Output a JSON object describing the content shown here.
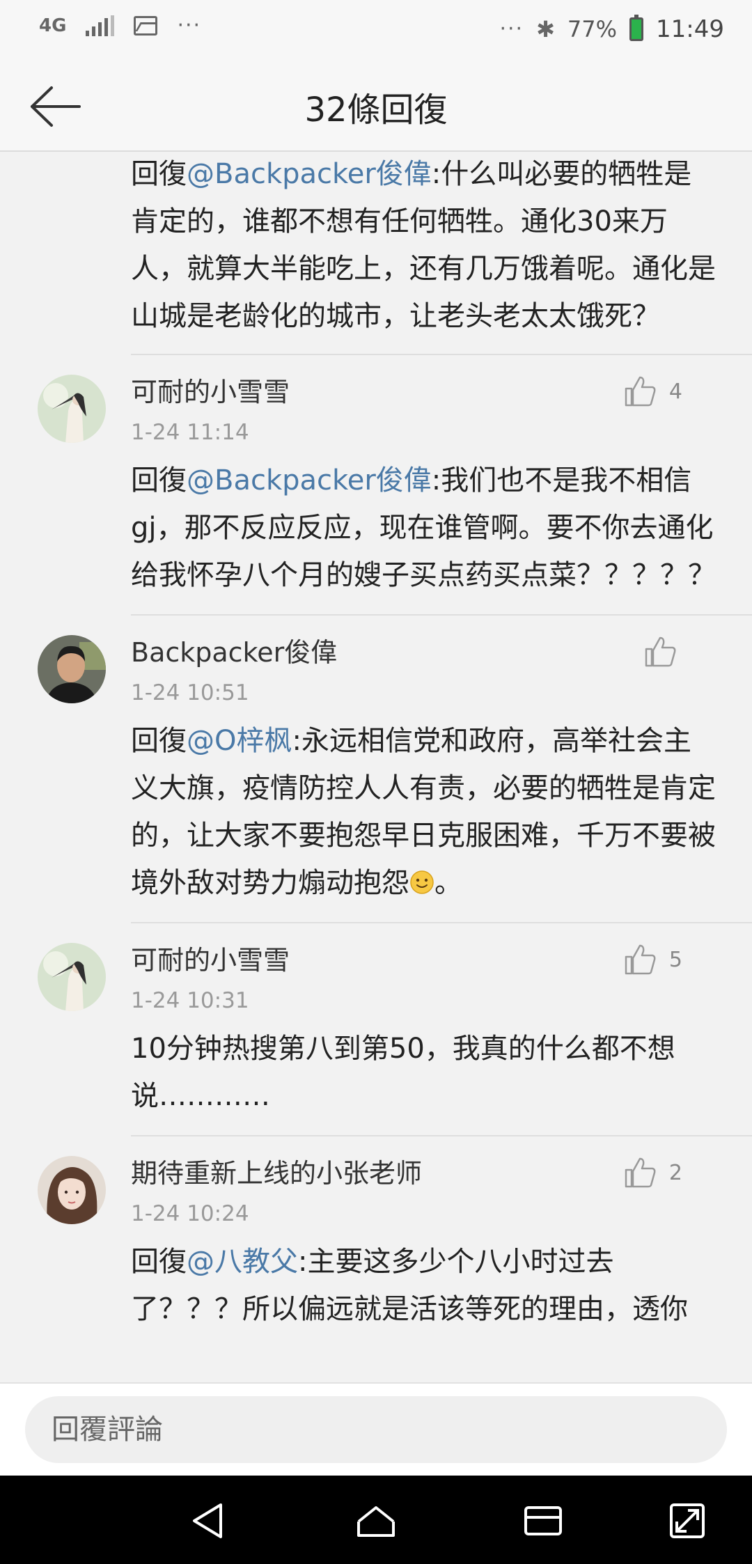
{
  "status_bar": {
    "network": "4G",
    "dots": "···",
    "battery_percent": "77%",
    "time": "11:49"
  },
  "header": {
    "title": "32條回復",
    "back_icon": "arrow-left-icon"
  },
  "reply_prefix": "回復",
  "continued_comment": {
    "mention": "@Backpacker俊偉",
    "text": ":什么叫必要的牺牲是肯定的，谁都不想有任何牺牲。通化30来万人，就算大半能吃上，还有几万饿着呢。通化是山城是老龄化的城市，让老头老太太饿死？"
  },
  "comments": [
    {
      "user": "可耐的小雪雪",
      "time": "1-24 11:14",
      "likes": "4",
      "mention": "@Backpacker俊偉",
      "text": ":我们也不是我不相信gj，那不反应反应，现在谁管啊。要不你去通化给我怀孕八个月的嫂子买点药买点菜？？？？？",
      "avatar": "woman-long-hair-avatar"
    },
    {
      "user": "Backpacker俊偉",
      "time": "1-24 10:51",
      "likes": "",
      "mention": "@O梓枫",
      "text": ":永远相信党和政府，高举社会主义大旗，疫情防控人人有责，必要的牺牲是肯定的，让大家不要抱怨早日克服困难，千万不要被境外敌对势力煽动抱怨",
      "text_after_emoji": "。",
      "avatar": "man-portrait-avatar"
    },
    {
      "user": "可耐的小雪雪",
      "time": "1-24 10:31",
      "likes": "5",
      "text": "10分钟热搜第八到第50，我真的什么都不想说…………",
      "avatar": "woman-long-hair-avatar"
    },
    {
      "user": "期待重新上线的小张老师",
      "time": "1-24 10:24",
      "likes": "2",
      "mention": "@八教父",
      "text": ":主要这多少个八小时过去了？？？所以偏远就是活该等死的理由，透你",
      "avatar": "girl-portrait-avatar"
    }
  ],
  "reply_bar": {
    "placeholder": "回覆評論"
  },
  "colors": {
    "mention": "#4a79a7",
    "background": "#f2f2f2",
    "divider": "#dedede"
  }
}
